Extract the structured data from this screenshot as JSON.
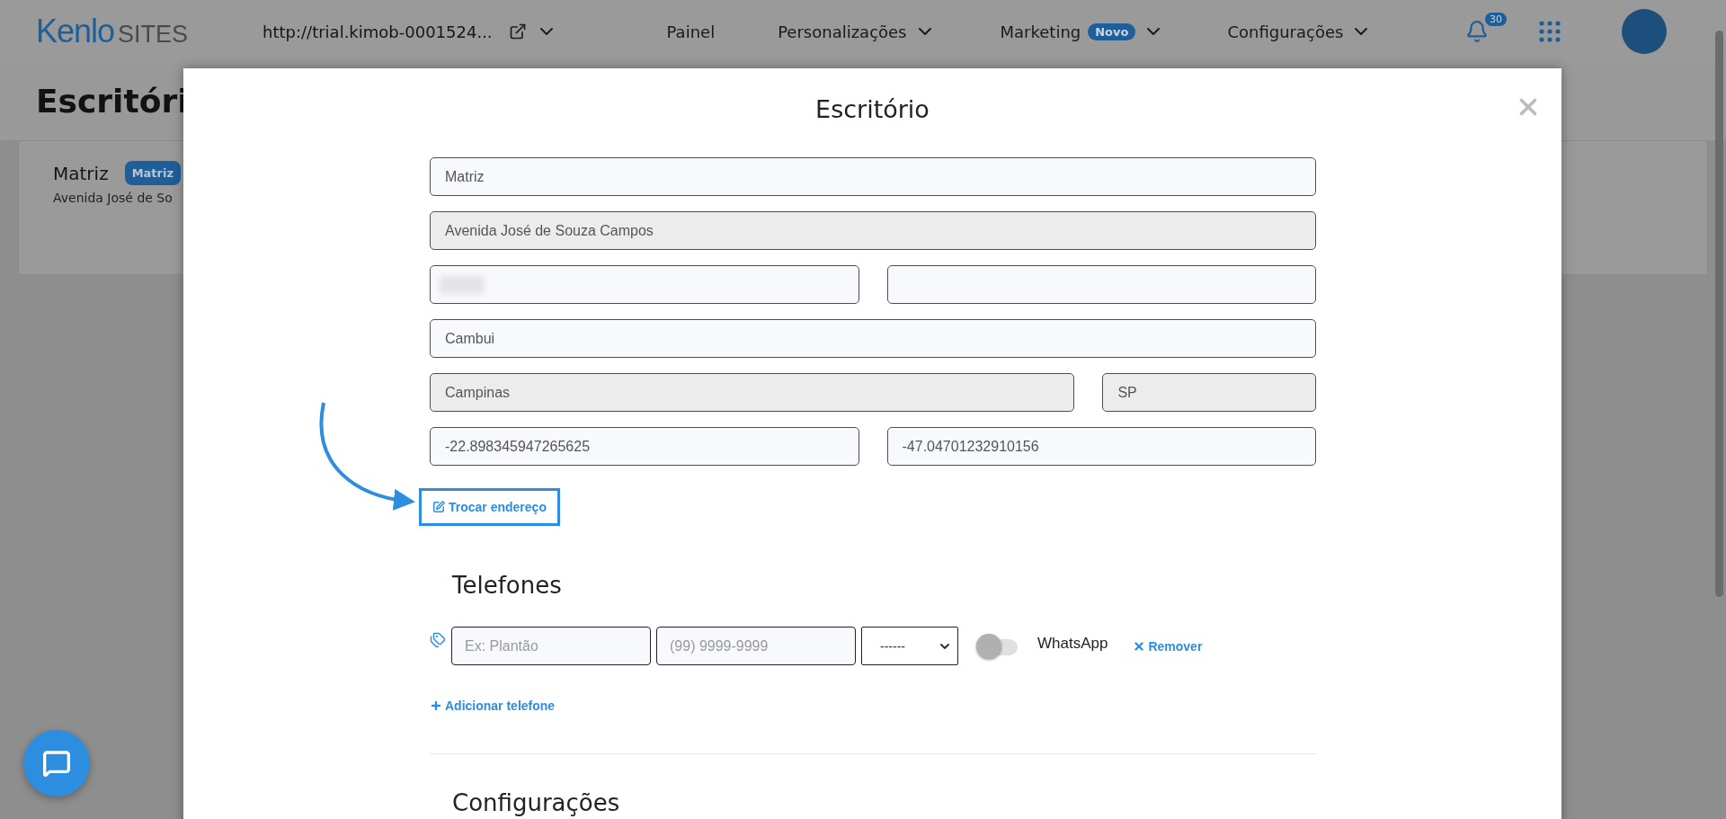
{
  "header": {
    "logo_primary": "Kenlo",
    "logo_secondary": "SITES",
    "site_url": "http://trial.kimob-0001524...",
    "nav": [
      {
        "label": "Painel",
        "dropdown": false
      },
      {
        "label": "Personalizações",
        "dropdown": true
      },
      {
        "label": "Marketing",
        "badge": "Novo",
        "dropdown": true
      },
      {
        "label": "Configurações",
        "dropdown": true
      }
    ],
    "notifications_count": "30"
  },
  "background": {
    "title": "Escritóri",
    "card": {
      "name": "Matriz",
      "badge": "Matriz",
      "address": "Avenida José de So"
    }
  },
  "modal": {
    "title": "Escritório",
    "rows": [
      {
        "kind": "single",
        "fields": [
          {
            "value": "Matriz",
            "readonly": false
          }
        ]
      },
      {
        "kind": "single",
        "fields": [
          {
            "value": "Avenida José de Souza Campos",
            "readonly": true
          }
        ]
      },
      {
        "kind": "pair",
        "fields": [
          {
            "readonly": false,
            "redacted": true
          },
          {
            "readonly": false
          }
        ]
      },
      {
        "kind": "single",
        "fields": [
          {
            "value": "Cambui",
            "readonly": false
          }
        ]
      },
      {
        "kind": "city-state",
        "fields": [
          {
            "value": "Campinas",
            "readonly": true
          },
          {
            "value": "SP",
            "readonly": true
          }
        ]
      },
      {
        "kind": "pair",
        "fields": [
          {
            "value": "-22.898345947265625",
            "readonly": false
          },
          {
            "value": "-47.04701232910156",
            "readonly": false
          }
        ]
      }
    ],
    "change_address_link": "Trocar endereço",
    "phones_title": "Telefones",
    "phones": [
      {
        "label_placeholder": "Ex: Plantão",
        "number_placeholder": "(99) 9999-9999",
        "type_select": "------",
        "whatsapp": false,
        "whatsapp_label": "WhatsApp",
        "remove_label": "Remover"
      }
    ],
    "add_phone_label": "Adicionar telefone",
    "settings_title": "Configurações"
  }
}
